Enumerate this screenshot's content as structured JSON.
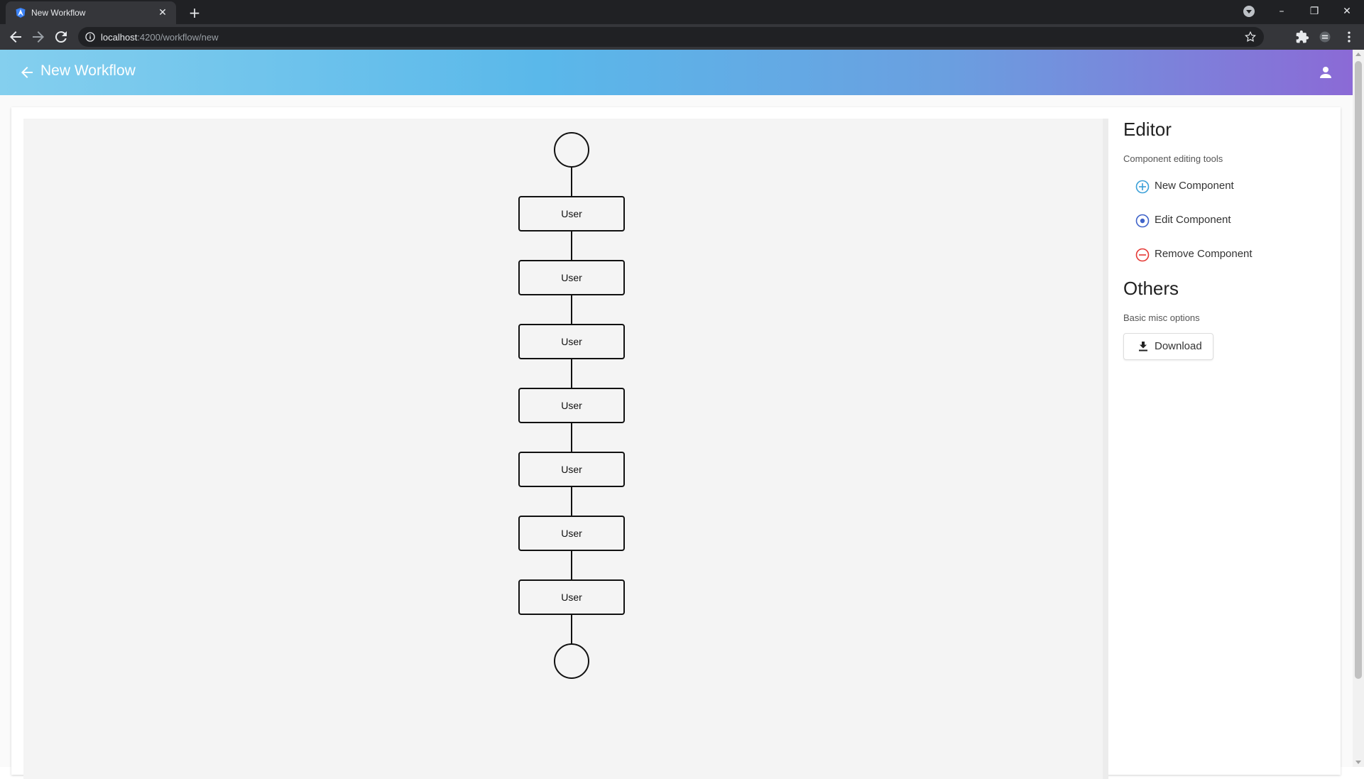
{
  "browser": {
    "tab_title": "New Workflow",
    "url_host": "localhost",
    "url_rest": ":4200/workflow/new"
  },
  "app": {
    "title": "New Workflow"
  },
  "workflow": {
    "nodes": [
      "User",
      "User",
      "User",
      "User",
      "User",
      "User",
      "User"
    ]
  },
  "editor": {
    "heading": "Editor",
    "subtitle": "Component editing tools",
    "tools": [
      {
        "label": "New Component",
        "icon": "plus-circle-icon",
        "color": "#3aa0d8"
      },
      {
        "label": "Edit Component",
        "icon": "radio-dot-icon",
        "color": "#3f63c9"
      },
      {
        "label": "Remove Component",
        "icon": "minus-circle-icon",
        "color": "#e53935"
      }
    ]
  },
  "others": {
    "heading": "Others",
    "subtitle": "Basic misc options",
    "download_label": "Download"
  }
}
